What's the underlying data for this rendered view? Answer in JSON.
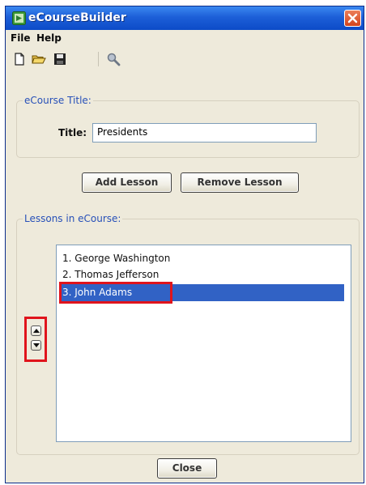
{
  "window": {
    "title": "eCourseBuilder"
  },
  "menu": {
    "items": [
      "File",
      "Help"
    ]
  },
  "toolbar": {
    "tools": [
      "new-file-icon",
      "open-folder-icon",
      "save-disk-icon",
      "search-magnifier-icon"
    ]
  },
  "title_group": {
    "heading": "eCourse Title:",
    "field_label": "Title:",
    "field_value": "Presidents"
  },
  "buttons": {
    "add_lesson": "Add Lesson",
    "remove_lesson": "Remove Lesson",
    "close": "Close"
  },
  "lessons_group": {
    "heading": "Lessons in eCourse:",
    "items": [
      "1. George Washington",
      "2. Thomas Jefferson",
      "3. John Adams"
    ],
    "selected_index": 2
  },
  "colors": {
    "window_bg": "#eeeadb",
    "titlebar_blue": "#1d5fd8",
    "selection_blue": "#3162c5",
    "highlight_red": "#e0141c",
    "group_heading": "#2750b8"
  }
}
